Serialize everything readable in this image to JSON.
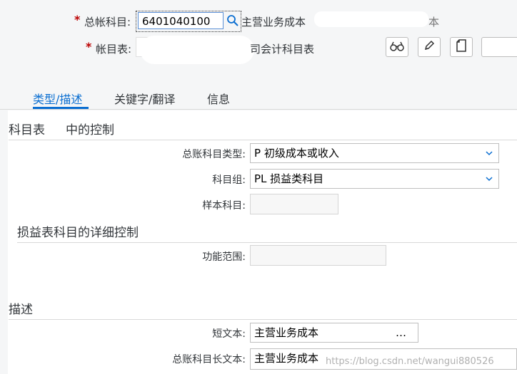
{
  "header": {
    "gl_account_label": "总帐科目:",
    "gl_account_value": "6401040100",
    "gl_account_desc": "主营业务成本",
    "gl_account_desc_tail": "本",
    "chart_label": "帐目表:",
    "chart_desc_tail": "司会计科目表"
  },
  "toolbar": {
    "display_icon": "glasses-icon",
    "edit_icon": "pencil-icon",
    "copy_icon": "document-icon"
  },
  "tabs": [
    {
      "label": "类型/描述"
    },
    {
      "label": "关键字/翻译"
    },
    {
      "label": "信息"
    }
  ],
  "section_control": {
    "title_left": "科目表",
    "title_right": "中的控制",
    "account_type_label": "总账科目类型:",
    "account_type_value": "P 初级成本或收入",
    "account_group_label": "科目组:",
    "account_group_value": "PL 损益类科目",
    "sample_account_label": "样本科目:",
    "sample_account_value": ""
  },
  "section_pl": {
    "title": "损益表科目的详细控制",
    "functional_area_label": "功能范围:",
    "functional_area_value": ""
  },
  "section_desc": {
    "title": "描述",
    "short_text_label": "短文本:",
    "short_text_value": "主营业务成本",
    "short_text_ellipsis": "…",
    "long_text_label": "总账科目长文本:",
    "long_text_value": "主营业务成本"
  },
  "watermark": "https://blog.csdn.net/wangui880526"
}
